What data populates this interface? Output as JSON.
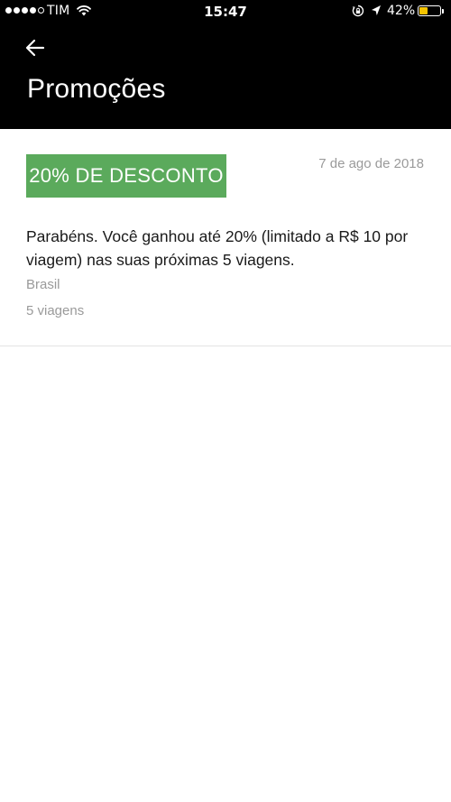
{
  "status_bar": {
    "carrier": "TIM",
    "time": "15:47",
    "battery_percent": "42%",
    "battery_level": 0.42,
    "signal_bars_filled": 4,
    "signal_bars_total": 5,
    "icons": [
      "wifi-icon",
      "rotation-lock-icon",
      "location-arrow-icon",
      "battery-icon"
    ]
  },
  "header": {
    "back_icon": "arrow-left-icon",
    "title": "Promoções"
  },
  "promotion": {
    "badge": "20% DE DESCONTO",
    "date": "7 de ago de 2018",
    "description": "Parabéns. Você ganhou até 20% (limitado a R$ 10 por viagem) nas suas próximas 5 viagens.",
    "region": "Brasil",
    "trips": "5 viagens"
  },
  "colors": {
    "header_bg": "#000000",
    "badge_bg": "#5baa5c",
    "secondary_text": "#9a9a9a",
    "battery_fill": "#f5c400"
  }
}
